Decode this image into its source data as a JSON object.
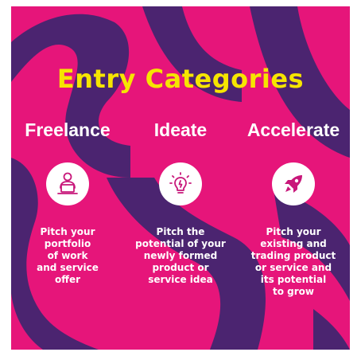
{
  "title": "Entry Categories",
  "colors": {
    "background_pink": "#e6157a",
    "pattern_purple": "#4b2470",
    "title_yellow": "#f6e500",
    "text_white": "#ffffff",
    "icon_pink": "#c8177a"
  },
  "categories": [
    {
      "heading": "Freelance",
      "icon": "person-at-laptop-icon",
      "description_lines": [
        "Pitch your",
        "portfolio",
        "of work",
        "and service",
        "offer"
      ]
    },
    {
      "heading": "Ideate",
      "icon": "lightbulb-icon",
      "description_lines": [
        "Pitch the",
        "potential of your",
        "newly formed",
        "product or",
        "service idea"
      ]
    },
    {
      "heading": "Accelerate",
      "icon": "rocket-icon",
      "description_lines": [
        "Pitch your",
        "existing and",
        "trading product",
        "or service and",
        "its potential",
        "to grow"
      ]
    }
  ]
}
